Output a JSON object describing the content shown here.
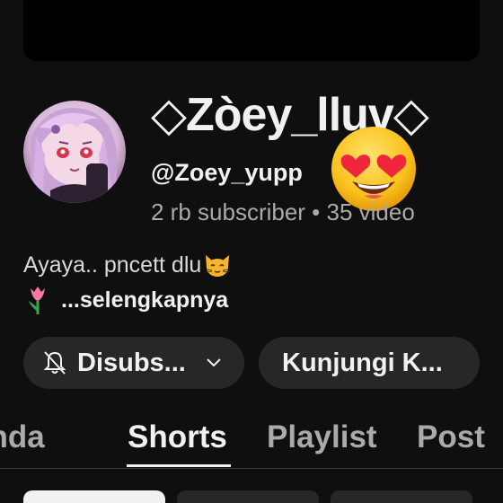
{
  "channel": {
    "name": "◇Zòey_lluv◇",
    "handle": "@Zoey_yupp",
    "stats": "2 rb subscriber • 35 video",
    "description": "Ayaya.. pncett dlu",
    "more_label": "...selengkapnya",
    "avatar_icon": "anime-girl-avatar",
    "overlay_emoji": "heart-eyes-emoji"
  },
  "actions": {
    "subscribe_label": "Disubs...",
    "visit_label": "Kunjungi K..."
  },
  "tabs": [
    {
      "label": "anda",
      "selected": false
    },
    {
      "label": "Shorts",
      "selected": true
    },
    {
      "label": "Playlist",
      "selected": false
    },
    {
      "label": "Post",
      "selected": false
    }
  ],
  "colors": {
    "background": "#0f0f0f",
    "button": "#272727",
    "text_primary": "#f1f1f1",
    "text_secondary": "#aaaaaa"
  }
}
